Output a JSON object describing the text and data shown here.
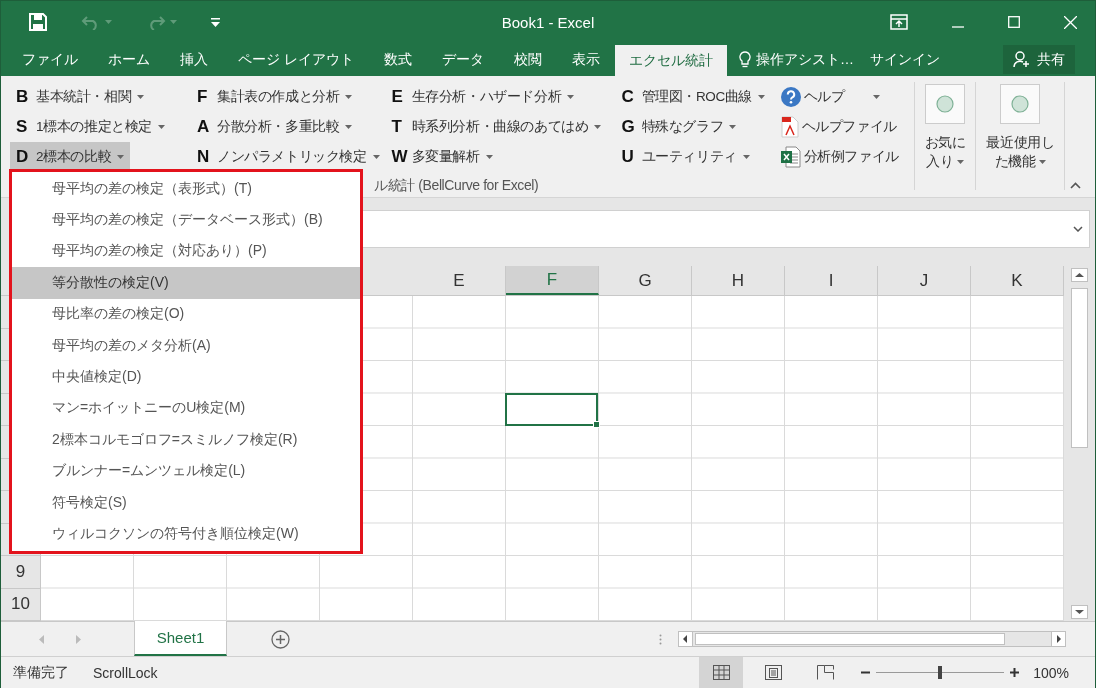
{
  "window": {
    "title": "Book1 - Excel"
  },
  "quick_access": [
    {
      "kind": "save",
      "disabled": false
    },
    {
      "kind": "undo",
      "disabled": true
    },
    {
      "kind": "redo",
      "disabled": true
    },
    {
      "kind": "customize",
      "disabled": false
    }
  ],
  "tabs": [
    {
      "label": "ファイル",
      "selected": false
    },
    {
      "label": "ホーム",
      "selected": false
    },
    {
      "label": "挿入",
      "selected": false
    },
    {
      "label": "ページ レイアウト",
      "selected": false
    },
    {
      "label": "数式",
      "selected": false
    },
    {
      "label": "データ",
      "selected": false
    },
    {
      "label": "校閲",
      "selected": false
    },
    {
      "label": "表示",
      "selected": false
    },
    {
      "label": "エクセル統計",
      "selected": true
    }
  ],
  "tell_me": "操作アシスト…",
  "sign_in": "サインイン",
  "share": "共有",
  "ribbon": {
    "columns": [
      {
        "commands": [
          {
            "letter": "B",
            "label": "基本統計・相関",
            "pressed": false
          },
          {
            "letter": "S",
            "label": "1標本の推定と検定",
            "pressed": false
          },
          {
            "letter": "D",
            "label": "2標本の比較",
            "pressed": true
          }
        ]
      },
      {
        "commands": [
          {
            "letter": "F",
            "label": "集計表の作成と分析",
            "pressed": false
          },
          {
            "letter": "A",
            "label": "分散分析・多重比較",
            "pressed": false
          },
          {
            "letter": "N",
            "label": "ノンパラメトリック検定",
            "pressed": false
          }
        ]
      },
      {
        "commands": [
          {
            "letter": "E",
            "label": "生存分析・ハザード分析",
            "pressed": false
          },
          {
            "letter": "T",
            "label": "時系列分析・曲線のあてはめ",
            "pressed": false
          },
          {
            "letter": "W",
            "label": "多変量解析",
            "pressed": false
          }
        ]
      },
      {
        "commands": [
          {
            "letter": "C",
            "label": "管理図・ROC曲線",
            "pressed": false
          },
          {
            "letter": "G",
            "label": "特殊なグラフ",
            "pressed": false
          },
          {
            "letter": "U",
            "label": "ユーティリティ",
            "pressed": false
          }
        ]
      }
    ],
    "help_items": [
      {
        "kind": "help",
        "label": "ヘルプ"
      },
      {
        "kind": "pdf",
        "label": "ヘルプファイル"
      },
      {
        "kind": "excel",
        "label": "分析例ファイル"
      }
    ],
    "large_buttons": [
      {
        "lines": [
          "お気に",
          "入り"
        ]
      },
      {
        "lines": [
          "最近使用し",
          "た機能"
        ]
      }
    ],
    "group_label": "ル統計 (BellCurve for Excel)"
  },
  "dropdown_menu": {
    "items": [
      {
        "label": "母平均の差の検定（表形式）(T)",
        "selected": false
      },
      {
        "label": "母平均の差の検定（データベース形式）(B)",
        "selected": false
      },
      {
        "label": "母平均の差の検定（対応あり）(P)",
        "selected": false
      },
      {
        "label": "等分散性の検定(V)",
        "selected": true
      },
      {
        "label": "母比率の差の検定(O)",
        "selected": false
      },
      {
        "label": "母平均の差のメタ分析(A)",
        "selected": false
      },
      {
        "label": "中央値検定(D)",
        "selected": false
      },
      {
        "label": "マン=ホイットニーのU検定(M)",
        "selected": false
      },
      {
        "label": "2標本コルモゴロフ=スミルノフ検定(R)",
        "selected": false
      },
      {
        "label": "ブルンナー=ムンツェル検定(L)",
        "selected": false
      },
      {
        "label": "符号検定(S)",
        "selected": false
      },
      {
        "label": "ウィルコクソンの符号付き順位検定(W)",
        "selected": false
      }
    ]
  },
  "sheet": {
    "columns": [
      {
        "label": "E",
        "selected": false
      },
      {
        "label": "F",
        "selected": true
      },
      {
        "label": "G",
        "selected": false
      },
      {
        "label": "H",
        "selected": false
      },
      {
        "label": "I",
        "selected": false
      },
      {
        "label": "J",
        "selected": false
      },
      {
        "label": "K",
        "selected": false
      }
    ],
    "rows": [
      "9",
      "10"
    ]
  },
  "sheet_tabs": [
    {
      "label": "Sheet1",
      "selected": true
    }
  ],
  "status_bar": {
    "texts": [
      "準備完了",
      "ScrollLock"
    ],
    "views": [
      {
        "kind": "normal",
        "selected": true
      },
      {
        "kind": "page-layout",
        "selected": false
      },
      {
        "kind": "page-break",
        "selected": false
      }
    ],
    "zoom": {
      "level": 0.5,
      "reading": "100%"
    }
  }
}
